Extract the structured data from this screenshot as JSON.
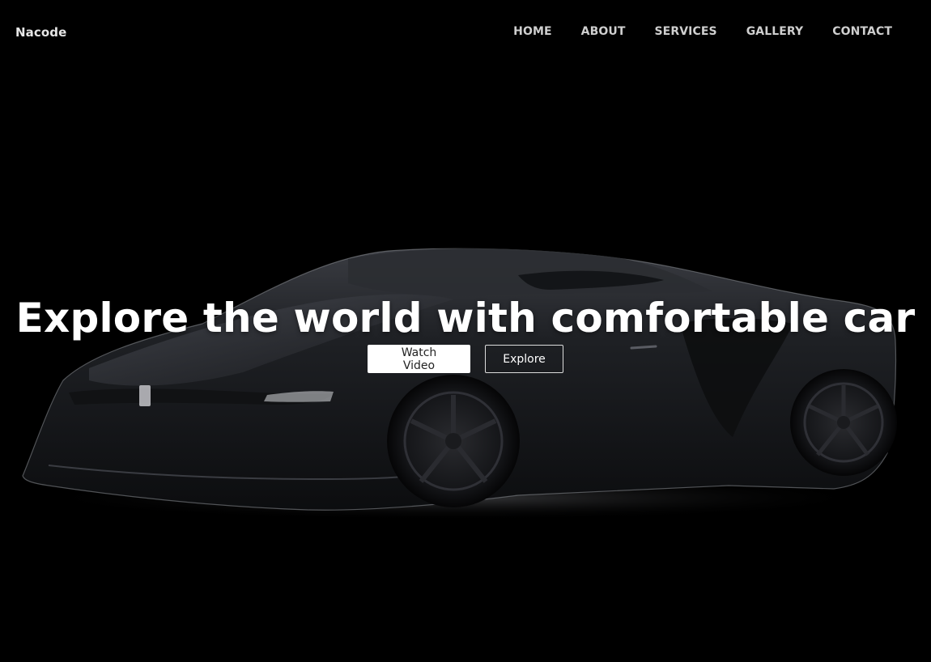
{
  "brand": {
    "name": "Nacode"
  },
  "nav": {
    "items": [
      {
        "label": "HOME"
      },
      {
        "label": "ABOUT"
      },
      {
        "label": "SERVICES"
      },
      {
        "label": "GALLERY"
      },
      {
        "label": "CONTACT"
      }
    ]
  },
  "hero": {
    "title": "Explore the world with comfortable car",
    "primary_button": "Watch Video",
    "secondary_button": "Explore",
    "image": "black-sports-car"
  },
  "colors": {
    "background": "#000000",
    "text": "#ffffff",
    "nav_text": "#cfcfcf"
  }
}
